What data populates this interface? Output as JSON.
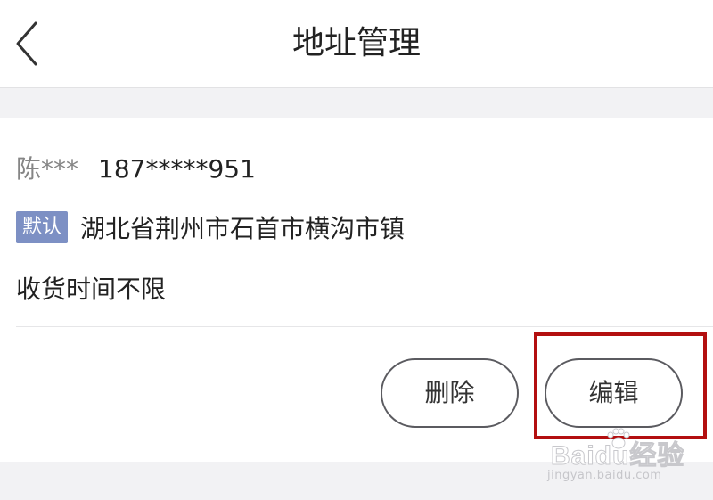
{
  "header": {
    "title": "地址管理",
    "back_icon": "chevron-left-icon"
  },
  "address": {
    "name": "陈***",
    "phone": "187*****951",
    "default_badge": "默认",
    "full_address": "湖北省荆州市石首市横沟市镇",
    "delivery_time": "收货时间不限"
  },
  "actions": {
    "delete_label": "删除",
    "edit_label": "编辑"
  },
  "watermark": {
    "logo_text": "Baidu经验",
    "url_text": "jingyan.baidu.com"
  },
  "colors": {
    "background": "#f2f2f4",
    "card": "#ffffff",
    "badge": "#7d90c4",
    "button_border": "#5b5b60",
    "highlight": "#b30f10"
  }
}
